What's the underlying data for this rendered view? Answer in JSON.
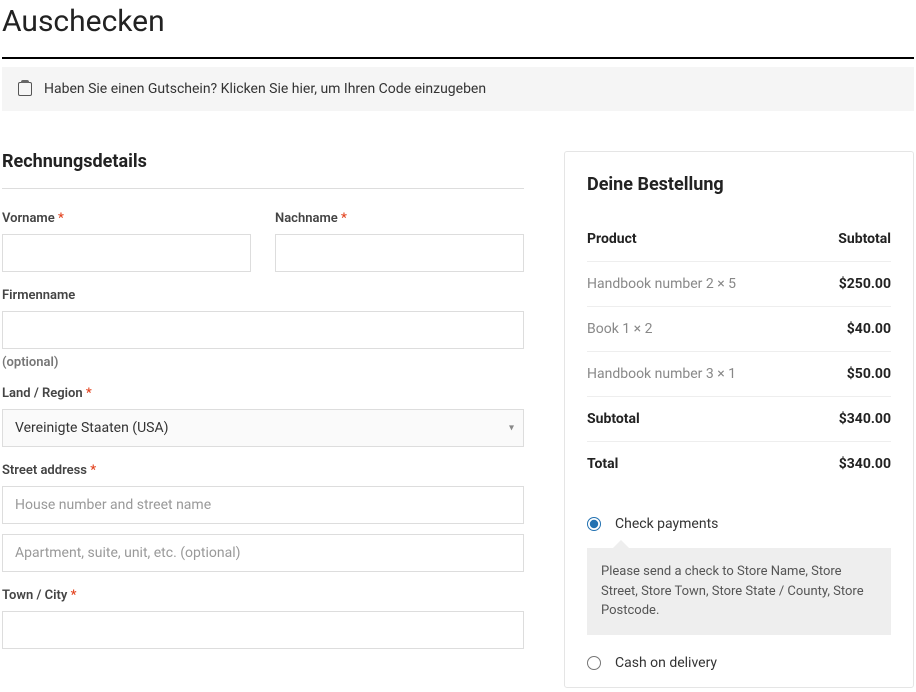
{
  "page_title": "Auschecken",
  "coupon": {
    "question": "Haben Sie einen Gutschein?",
    "link": "Klicken Sie hier, um Ihren Code einzugeben"
  },
  "billing": {
    "heading": "Rechnungsdetails",
    "first_name_label": "Vorname",
    "last_name_label": "Nachname",
    "company_label": "Firmenname",
    "company_optional": "(optional)",
    "country_label": "Land / Region",
    "country_value": "Vereinigte Staaten (USA)",
    "street_label": "Street address",
    "street1_placeholder": "House number and street name",
    "street2_placeholder": "Apartment, suite, unit, etc. (optional)",
    "city_label": "Town / City"
  },
  "order": {
    "heading": "Deine Bestellung",
    "col_product": "Product",
    "col_subtotal": "Subtotal",
    "items": [
      {
        "name": "Handbook number 2",
        "qty": "× 5",
        "price": "$250.00"
      },
      {
        "name": "Book 1",
        "qty": "× 2",
        "price": "$40.00"
      },
      {
        "name": "Handbook number 3",
        "qty": "× 1",
        "price": "$50.00"
      }
    ],
    "subtotal_label": "Subtotal",
    "subtotal_value": "$340.00",
    "total_label": "Total",
    "total_value": "$340.00"
  },
  "payment": {
    "check_label": "Check payments",
    "check_desc": "Please send a check to Store Name, Store Street, Store Town, Store State / County, Store Postcode.",
    "cod_label": "Cash on delivery"
  }
}
